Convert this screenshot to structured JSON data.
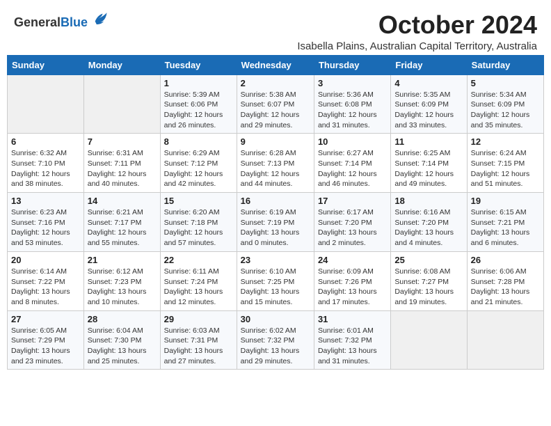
{
  "logo": {
    "general": "General",
    "blue": "Blue"
  },
  "header": {
    "month": "October 2024",
    "subtitle": "Isabella Plains, Australian Capital Territory, Australia"
  },
  "days_of_week": [
    "Sunday",
    "Monday",
    "Tuesday",
    "Wednesday",
    "Thursday",
    "Friday",
    "Saturday"
  ],
  "weeks": [
    [
      {
        "day": "",
        "info": ""
      },
      {
        "day": "",
        "info": ""
      },
      {
        "day": "1",
        "info": "Sunrise: 5:39 AM\nSunset: 6:06 PM\nDaylight: 12 hours\nand 26 minutes."
      },
      {
        "day": "2",
        "info": "Sunrise: 5:38 AM\nSunset: 6:07 PM\nDaylight: 12 hours\nand 29 minutes."
      },
      {
        "day": "3",
        "info": "Sunrise: 5:36 AM\nSunset: 6:08 PM\nDaylight: 12 hours\nand 31 minutes."
      },
      {
        "day": "4",
        "info": "Sunrise: 5:35 AM\nSunset: 6:09 PM\nDaylight: 12 hours\nand 33 minutes."
      },
      {
        "day": "5",
        "info": "Sunrise: 5:34 AM\nSunset: 6:09 PM\nDaylight: 12 hours\nand 35 minutes."
      }
    ],
    [
      {
        "day": "6",
        "info": "Sunrise: 6:32 AM\nSunset: 7:10 PM\nDaylight: 12 hours\nand 38 minutes."
      },
      {
        "day": "7",
        "info": "Sunrise: 6:31 AM\nSunset: 7:11 PM\nDaylight: 12 hours\nand 40 minutes."
      },
      {
        "day": "8",
        "info": "Sunrise: 6:29 AM\nSunset: 7:12 PM\nDaylight: 12 hours\nand 42 minutes."
      },
      {
        "day": "9",
        "info": "Sunrise: 6:28 AM\nSunset: 7:13 PM\nDaylight: 12 hours\nand 44 minutes."
      },
      {
        "day": "10",
        "info": "Sunrise: 6:27 AM\nSunset: 7:14 PM\nDaylight: 12 hours\nand 46 minutes."
      },
      {
        "day": "11",
        "info": "Sunrise: 6:25 AM\nSunset: 7:14 PM\nDaylight: 12 hours\nand 49 minutes."
      },
      {
        "day": "12",
        "info": "Sunrise: 6:24 AM\nSunset: 7:15 PM\nDaylight: 12 hours\nand 51 minutes."
      }
    ],
    [
      {
        "day": "13",
        "info": "Sunrise: 6:23 AM\nSunset: 7:16 PM\nDaylight: 12 hours\nand 53 minutes."
      },
      {
        "day": "14",
        "info": "Sunrise: 6:21 AM\nSunset: 7:17 PM\nDaylight: 12 hours\nand 55 minutes."
      },
      {
        "day": "15",
        "info": "Sunrise: 6:20 AM\nSunset: 7:18 PM\nDaylight: 12 hours\nand 57 minutes."
      },
      {
        "day": "16",
        "info": "Sunrise: 6:19 AM\nSunset: 7:19 PM\nDaylight: 13 hours\nand 0 minutes."
      },
      {
        "day": "17",
        "info": "Sunrise: 6:17 AM\nSunset: 7:20 PM\nDaylight: 13 hours\nand 2 minutes."
      },
      {
        "day": "18",
        "info": "Sunrise: 6:16 AM\nSunset: 7:20 PM\nDaylight: 13 hours\nand 4 minutes."
      },
      {
        "day": "19",
        "info": "Sunrise: 6:15 AM\nSunset: 7:21 PM\nDaylight: 13 hours\nand 6 minutes."
      }
    ],
    [
      {
        "day": "20",
        "info": "Sunrise: 6:14 AM\nSunset: 7:22 PM\nDaylight: 13 hours\nand 8 minutes."
      },
      {
        "day": "21",
        "info": "Sunrise: 6:12 AM\nSunset: 7:23 PM\nDaylight: 13 hours\nand 10 minutes."
      },
      {
        "day": "22",
        "info": "Sunrise: 6:11 AM\nSunset: 7:24 PM\nDaylight: 13 hours\nand 12 minutes."
      },
      {
        "day": "23",
        "info": "Sunrise: 6:10 AM\nSunset: 7:25 PM\nDaylight: 13 hours\nand 15 minutes."
      },
      {
        "day": "24",
        "info": "Sunrise: 6:09 AM\nSunset: 7:26 PM\nDaylight: 13 hours\nand 17 minutes."
      },
      {
        "day": "25",
        "info": "Sunrise: 6:08 AM\nSunset: 7:27 PM\nDaylight: 13 hours\nand 19 minutes."
      },
      {
        "day": "26",
        "info": "Sunrise: 6:06 AM\nSunset: 7:28 PM\nDaylight: 13 hours\nand 21 minutes."
      }
    ],
    [
      {
        "day": "27",
        "info": "Sunrise: 6:05 AM\nSunset: 7:29 PM\nDaylight: 13 hours\nand 23 minutes."
      },
      {
        "day": "28",
        "info": "Sunrise: 6:04 AM\nSunset: 7:30 PM\nDaylight: 13 hours\nand 25 minutes."
      },
      {
        "day": "29",
        "info": "Sunrise: 6:03 AM\nSunset: 7:31 PM\nDaylight: 13 hours\nand 27 minutes."
      },
      {
        "day": "30",
        "info": "Sunrise: 6:02 AM\nSunset: 7:32 PM\nDaylight: 13 hours\nand 29 minutes."
      },
      {
        "day": "31",
        "info": "Sunrise: 6:01 AM\nSunset: 7:32 PM\nDaylight: 13 hours\nand 31 minutes."
      },
      {
        "day": "",
        "info": ""
      },
      {
        "day": "",
        "info": ""
      }
    ]
  ]
}
